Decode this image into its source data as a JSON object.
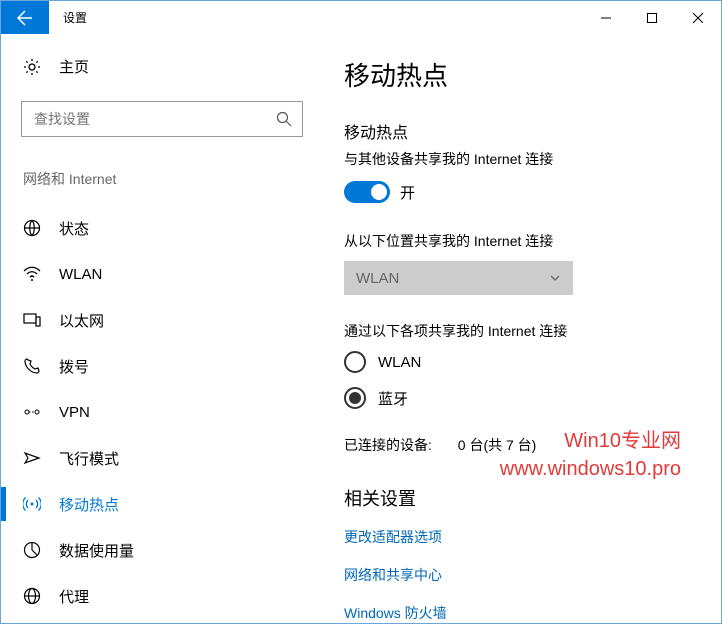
{
  "window": {
    "title": "设置"
  },
  "sidebar": {
    "home": "主页",
    "search_placeholder": "查找设置",
    "section": "网络和 Internet",
    "items": [
      {
        "label": "状态"
      },
      {
        "label": "WLAN"
      },
      {
        "label": "以太网"
      },
      {
        "label": "拨号"
      },
      {
        "label": "VPN"
      },
      {
        "label": "飞行模式"
      },
      {
        "label": "移动热点"
      },
      {
        "label": "数据使用量"
      },
      {
        "label": "代理"
      }
    ]
  },
  "main": {
    "heading": "移动热点",
    "share_heading": "移动热点",
    "share_desc": "与其他设备共享我的 Internet 连接",
    "toggle_state": "开",
    "from_label": "从以下位置共享我的 Internet 连接",
    "from_value": "WLAN",
    "via_label": "通过以下各项共享我的 Internet 连接",
    "radio_wlan": "WLAN",
    "radio_bt": "蓝牙",
    "connected_label": "已连接的设备:",
    "connected_value": "0 台(共 7 台)",
    "related_heading": "相关设置",
    "link_adapter": "更改适配器选项",
    "link_sharing": "网络和共享中心",
    "link_firewall": "Windows 防火墙"
  },
  "watermark": {
    "line1": "Win10专业网",
    "line2": "www.windows10.pro"
  }
}
